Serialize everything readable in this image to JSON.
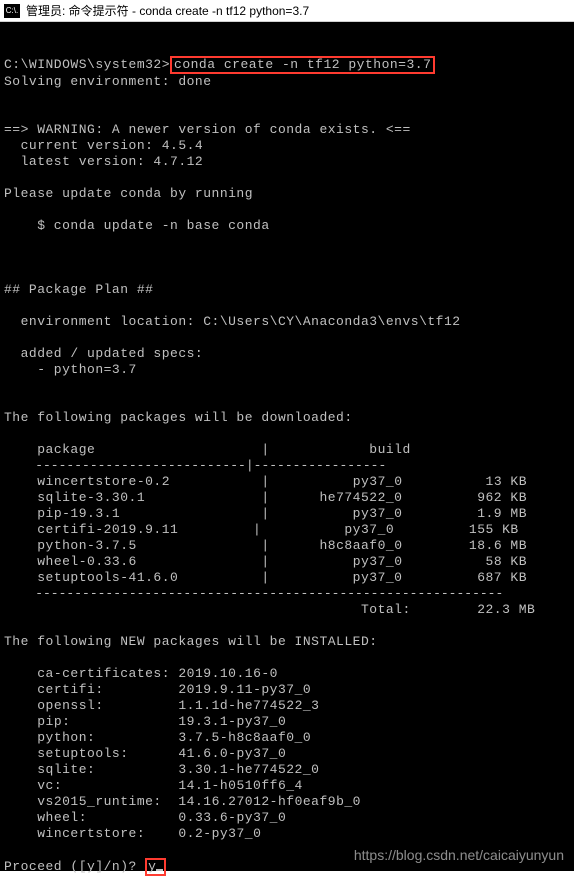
{
  "titlebar": {
    "icon_label": "C:\\.",
    "title": "管理员: 命令提示符 - conda  create -n tf12 python=3.7"
  },
  "prompt": {
    "path": "C:\\WINDOWS\\system32>",
    "command": "conda create -n tf12 python=3.7",
    "solving": "Solving environment: done"
  },
  "warning": {
    "line1": "==> WARNING: A newer version of conda exists. <==",
    "current": "  current version: 4.5.4",
    "latest": "  latest version: 4.7.12"
  },
  "update": {
    "msg": "Please update conda by running",
    "cmd": "    $ conda update -n base conda"
  },
  "plan": {
    "header": "## Package Plan ##",
    "env_loc": "  environment location: C:\\Users\\CY\\Anaconda3\\envs\\tf12",
    "added": "  added / updated specs:",
    "spec": "    - python=3.7"
  },
  "dl": {
    "header": "The following packages will be downloaded:",
    "col_pkg": "package",
    "col_build": "build",
    "rows": [
      {
        "pkg": "wincertstore-0.2",
        "build": "py37_0",
        "size": "13 KB"
      },
      {
        "pkg": "sqlite-3.30.1",
        "build": "he774522_0",
        "size": "962 KB"
      },
      {
        "pkg": "pip-19.3.1",
        "build": "py37_0",
        "size": "1.9 MB"
      },
      {
        "pkg": "certifi-2019.9.11",
        "build": "py37_0",
        "size": "155 KB"
      },
      {
        "pkg": "python-3.7.5",
        "build": "h8c8aaf0_0",
        "size": "18.6 MB"
      },
      {
        "pkg": "wheel-0.33.6",
        "build": "py37_0",
        "size": "58 KB"
      },
      {
        "pkg": "setuptools-41.6.0",
        "build": "py37_0",
        "size": "687 KB"
      }
    ],
    "total_label": "Total:",
    "total_value": "22.3 MB"
  },
  "install": {
    "header": "The following NEW packages will be INSTALLED:",
    "rows": [
      {
        "name": "ca-certificates:",
        "ver": "2019.10.16-0"
      },
      {
        "name": "certifi:",
        "ver": "2019.9.11-py37_0"
      },
      {
        "name": "openssl:",
        "ver": "1.1.1d-he774522_3"
      },
      {
        "name": "pip:",
        "ver": "19.3.1-py37_0"
      },
      {
        "name": "python:",
        "ver": "3.7.5-h8c8aaf0_0"
      },
      {
        "name": "setuptools:",
        "ver": "41.6.0-py37_0"
      },
      {
        "name": "sqlite:",
        "ver": "3.30.1-he774522_0"
      },
      {
        "name": "vc:",
        "ver": "14.1-h0510ff6_4"
      },
      {
        "name": "vs2015_runtime:",
        "ver": "14.16.27012-hf0eaf9b_0"
      },
      {
        "name": "wheel:",
        "ver": "0.33.6-py37_0"
      },
      {
        "name": "wincertstore:",
        "ver": "0.2-py37_0"
      }
    ]
  },
  "proceed": {
    "prompt": "Proceed ([y]/n)? ",
    "answer": "y"
  },
  "watermark": "https://blog.csdn.net/caicaiyunyun"
}
